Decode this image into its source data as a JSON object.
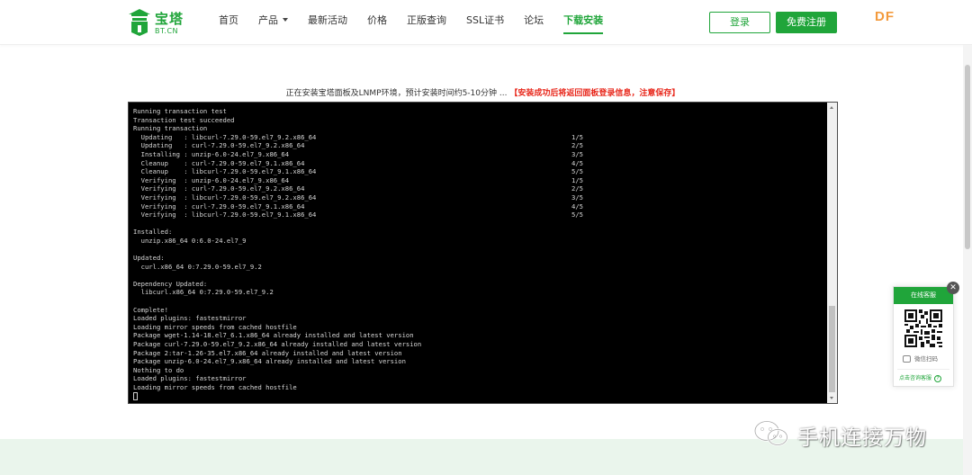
{
  "brand": {
    "name": "宝塔",
    "domain": "BT.CN",
    "color": "#20a53a"
  },
  "nav": {
    "items": [
      {
        "label": "首页",
        "dropdown": false,
        "active": false
      },
      {
        "label": "产品",
        "dropdown": true,
        "active": false
      },
      {
        "label": "最新活动",
        "dropdown": false,
        "active": false
      },
      {
        "label": "价格",
        "dropdown": false,
        "active": false
      },
      {
        "label": "正版查询",
        "dropdown": false,
        "active": false
      },
      {
        "label": "SSL证书",
        "dropdown": false,
        "active": false
      },
      {
        "label": "论坛",
        "dropdown": false,
        "active": false
      },
      {
        "label": "下载安装",
        "dropdown": false,
        "active": true
      }
    ]
  },
  "header": {
    "login_label": "登录",
    "register_label": "免费注册",
    "corner_mark": "DF"
  },
  "notice": {
    "main": "正在安装宝塔面板及LNMP环境，预计安装时间约5-10分钟 ...",
    "warning": "【安装成功后将返回面板登录信息，注意保存】",
    "warning_color": "#e8281c"
  },
  "terminal": {
    "lines": [
      {
        "text": "Running transaction test"
      },
      {
        "text": "Transaction test succeeded"
      },
      {
        "text": "Running transaction"
      },
      {
        "text": "  Updating   : libcurl-7.29.0-59.el7_9.2.x86_64",
        "count": "1/5"
      },
      {
        "text": "  Updating   : curl-7.29.0-59.el7_9.2.x86_64",
        "count": "2/5"
      },
      {
        "text": "  Installing : unzip-6.0-24.el7_9.x86_64",
        "count": "3/5"
      },
      {
        "text": "  Cleanup    : curl-7.29.0-59.el7_9.1.x86_64",
        "count": "4/5"
      },
      {
        "text": "  Cleanup    : libcurl-7.29.0-59.el7_9.1.x86_64",
        "count": "5/5"
      },
      {
        "text": "  Verifying  : unzip-6.0-24.el7_9.x86_64",
        "count": "1/5"
      },
      {
        "text": "  Verifying  : curl-7.29.0-59.el7_9.2.x86_64",
        "count": "2/5"
      },
      {
        "text": "  Verifying  : libcurl-7.29.0-59.el7_9.2.x86_64",
        "count": "3/5"
      },
      {
        "text": "  Verifying  : curl-7.29.0-59.el7_9.1.x86_64",
        "count": "4/5"
      },
      {
        "text": "  Verifying  : libcurl-7.29.0-59.el7_9.1.x86_64",
        "count": "5/5"
      },
      {
        "text": ""
      },
      {
        "text": "Installed:"
      },
      {
        "text": "  unzip.x86_64 0:6.0-24.el7_9"
      },
      {
        "text": ""
      },
      {
        "text": "Updated:"
      },
      {
        "text": "  curl.x86_64 0:7.29.0-59.el7_9.2"
      },
      {
        "text": ""
      },
      {
        "text": "Dependency Updated:"
      },
      {
        "text": "  libcurl.x86_64 0:7.29.0-59.el7_9.2"
      },
      {
        "text": ""
      },
      {
        "text": "Complete!"
      },
      {
        "text": "Loaded plugins: fastestmirror"
      },
      {
        "text": "Loading mirror speeds from cached hostfile"
      },
      {
        "text": "Package wget-1.14-18.el7_6.1.x86_64 already installed and latest version"
      },
      {
        "text": "Package curl-7.29.0-59.el7_9.2.x86_64 already installed and latest version"
      },
      {
        "text": "Package 2:tar-1.26-35.el7.x86_64 already installed and latest version"
      },
      {
        "text": "Package unzip-6.0-24.el7_9.x86_64 already installed and latest version"
      },
      {
        "text": "Nothing to do"
      },
      {
        "text": "Loaded plugins: fastestmirror"
      },
      {
        "text": "Loading mirror speeds from cached hostfile"
      },
      {
        "text": "",
        "cursor": true
      }
    ]
  },
  "service": {
    "title": "在线客服",
    "close": "✕",
    "scan_label": "微信扫码",
    "consult_label": "点击咨询客服",
    "help_glyph": "?"
  },
  "watermark": {
    "text": "手机连接万物"
  }
}
